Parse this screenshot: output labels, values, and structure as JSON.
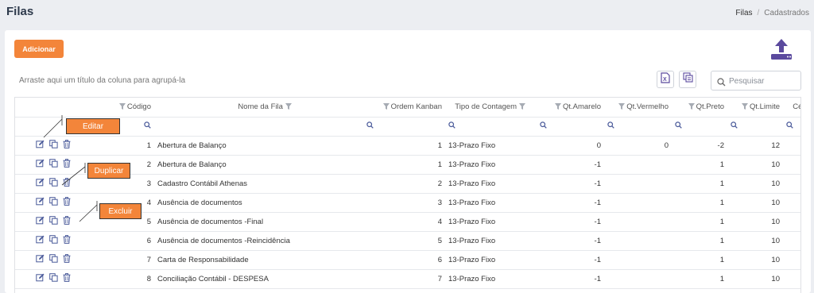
{
  "page": {
    "title": "Filas",
    "breadcrumb": [
      "Filas",
      "Cadastrados"
    ]
  },
  "toolbar": {
    "add_label": "Adicionar",
    "group_hint": "Arraste aqui um título da coluna para agrupá-la",
    "search_placeholder": "Pesquisar"
  },
  "grid": {
    "columns": [
      "Código",
      "Nome da Fila",
      "Ordem Kanban",
      "Tipo de Contagem",
      "Qt.Amarelo",
      "Qt.Vermelho",
      "Qt.Preto",
      "Qt.Limite",
      "Célu"
    ],
    "rows": [
      {
        "codigo": "1",
        "nome": "Abertura de Balanço",
        "ordem": "1",
        "tipo": "13-Prazo Fixo",
        "amarelo": "0",
        "vermelho": "0",
        "preto": "-2",
        "limite": "12"
      },
      {
        "codigo": "2",
        "nome": "Abertura de Balanço",
        "ordem": "1",
        "tipo": "13-Prazo Fixo",
        "amarelo": "-1",
        "vermelho": "",
        "preto": "1",
        "limite": "10"
      },
      {
        "codigo": "3",
        "nome": "Cadastro Contábil Athenas",
        "ordem": "2",
        "tipo": "13-Prazo Fixo",
        "amarelo": "-1",
        "vermelho": "",
        "preto": "1",
        "limite": "10"
      },
      {
        "codigo": "4",
        "nome": "Ausência de documentos",
        "ordem": "3",
        "tipo": "13-Prazo Fixo",
        "amarelo": "-1",
        "vermelho": "",
        "preto": "1",
        "limite": "10"
      },
      {
        "codigo": "5",
        "nome": "Ausência de documentos -Final",
        "ordem": "4",
        "tipo": "13-Prazo Fixo",
        "amarelo": "-1",
        "vermelho": "",
        "preto": "1",
        "limite": "10"
      },
      {
        "codigo": "6",
        "nome": "Ausência de documentos -Reincidência",
        "ordem": "5",
        "tipo": "13-Prazo Fixo",
        "amarelo": "-1",
        "vermelho": "",
        "preto": "1",
        "limite": "10"
      },
      {
        "codigo": "7",
        "nome": "Carta de Responsabilidade",
        "ordem": "6",
        "tipo": "13-Prazo Fixo",
        "amarelo": "-1",
        "vermelho": "",
        "preto": "1",
        "limite": "10"
      },
      {
        "codigo": "8",
        "nome": "Conciliação Contábil - DESPESA",
        "ordem": "7",
        "tipo": "13-Prazo Fixo",
        "amarelo": "-1",
        "vermelho": "",
        "preto": "1",
        "limite": "10"
      }
    ]
  },
  "callouts": {
    "editar": "Editar",
    "duplicar": "Duplicar",
    "excluir": "Excluir"
  },
  "icons": {
    "edit": "edit-icon",
    "duplicate": "duplicate-icon",
    "delete": "trash-icon",
    "filter": "filter-icon",
    "search": "search-icon",
    "upload": "upload-icon",
    "excel": "excel-export-icon",
    "columns": "column-chooser-icon"
  },
  "colors": {
    "accent": "#f3853a",
    "brand": "#5b4a9e",
    "background": "#eceef2"
  }
}
